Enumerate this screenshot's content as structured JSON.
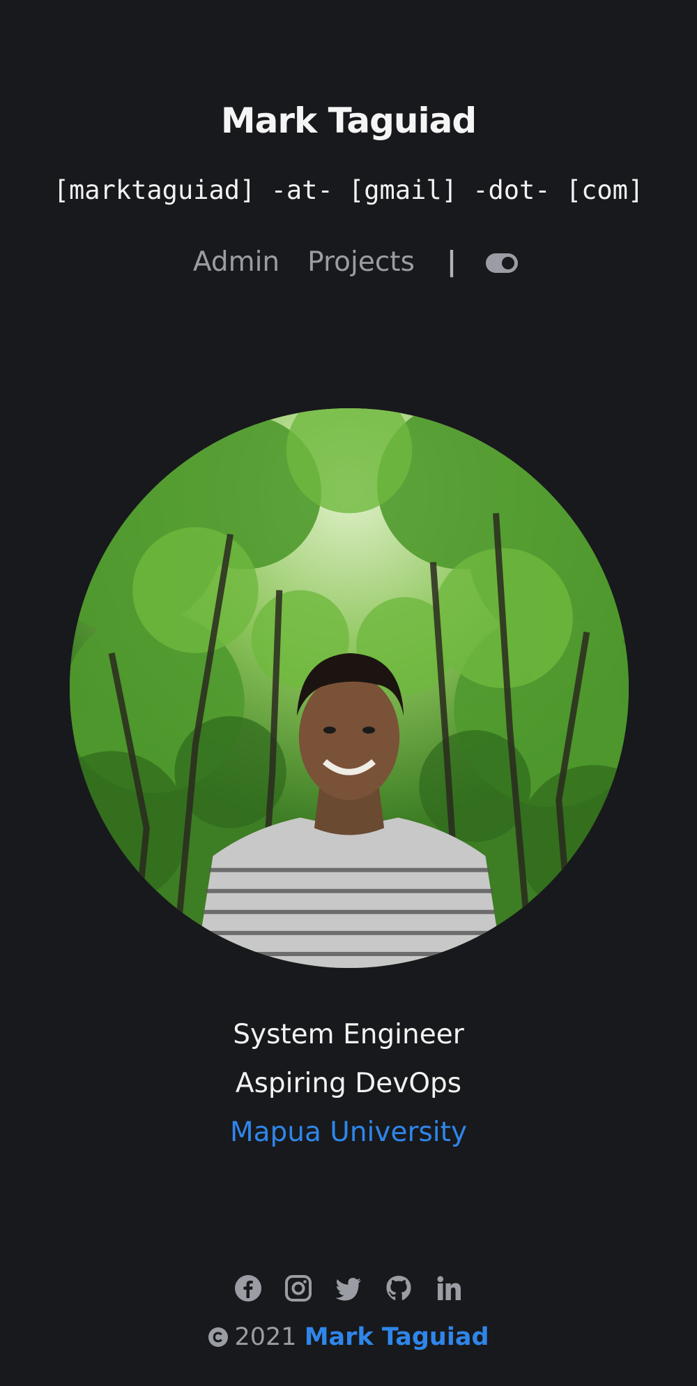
{
  "header": {
    "title": "Mark Taguiad",
    "email": "[marktaguiad] -at- [gmail] -dot- [com]"
  },
  "nav": {
    "items": [
      {
        "label": "Admin"
      },
      {
        "label": "Projects"
      }
    ],
    "separator": "|",
    "theme_toggle_icon": "toggle-on-icon"
  },
  "profile": {
    "photo_icon": "profile-photo"
  },
  "bio": {
    "role": "System Engineer",
    "aspiration": "Aspiring DevOps",
    "school": "Mapua University"
  },
  "social": {
    "icons": [
      "facebook-icon",
      "instagram-icon",
      "twitter-icon",
      "github-icon",
      "linkedin-icon"
    ]
  },
  "footer": {
    "year": "2021",
    "author": "Mark Taguiad",
    "copyright_icon": "copyright-icon"
  },
  "colors": {
    "background": "#18191c",
    "accent": "#2f86ea",
    "muted": "#9a9da3",
    "text": "#f2f2f2"
  }
}
